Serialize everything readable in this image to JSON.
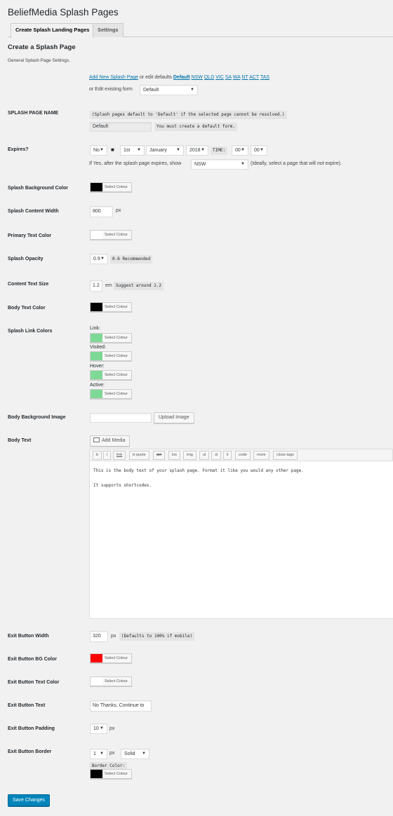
{
  "app_title": "BeliefMedia Splash Pages",
  "tabs": [
    "Create Splash Landing Pages",
    "Settings"
  ],
  "heading": "Create a Splash Page",
  "description": "General Splash Page Settings.",
  "nav": {
    "add_new": "Add New Splash Page",
    "edit_defaults_text": "or edit defaults",
    "default_link": "Default",
    "state_links": [
      "NSW",
      "QLD",
      "VIC",
      "SA",
      "WA",
      "NT",
      "ACT",
      "TAS"
    ],
    "edit_existing_text": "or Edit existing form",
    "existing_value": "Default"
  },
  "labels": {
    "name": "SPLASH PAGE NAME",
    "expires": "Expires?",
    "bg_color": "Splash Background Color",
    "content_width": "Splash Content Width",
    "primary_text": "Primary Text Color",
    "opacity": "Splash Opacity",
    "text_size": "Content Text Size",
    "body_text_color": "Body Text Color",
    "link_colors": "Splash Link Colors",
    "bg_image": "Body Background Image",
    "body_text": "Body Text",
    "exit_width": "Exit Button Width",
    "exit_bg": "Exit Button BG Color",
    "exit_text_color": "Exit Button Text Color",
    "exit_text": "Exit Button Text",
    "exit_padding": "Exit Button Padding",
    "exit_border": "Exit Button Border"
  },
  "name": {
    "note": "(Splash pages default to 'Default' if the selected page cannot be resolved.)",
    "value": "Default",
    "warning": "You must create a default form."
  },
  "expires": {
    "enabled": "No",
    "square": "■",
    "day": "1st",
    "month": "January",
    "year": "2018",
    "time_label": "TIME:",
    "hour": "00",
    "minute": "00",
    "after_text": "If Yes, after the splash page expires, show",
    "after_value": "NSW",
    "hint_pre": "(Ideally, select a page that will",
    "hint_em": "not",
    "hint_post": "expire)."
  },
  "select_colour": "Select Colour",
  "colors": {
    "bg": "#000000",
    "primary_text": "#ffffff",
    "body_text": "#000000",
    "link": "#7ed896",
    "visited": "#7ed896",
    "hover": "#7ed896",
    "active": "#7ed896",
    "exit_bg": "#ff0000",
    "exit_text": "#ffffff",
    "border": "#000000"
  },
  "content_width": {
    "value": "800",
    "unit": "px"
  },
  "opacity": {
    "value": "0.9",
    "note": "0.6 Recommended"
  },
  "text_size": {
    "value": "1.2",
    "unit": "em",
    "note": "Suggest around 1.2"
  },
  "link_labels": {
    "link": "Link:",
    "visited": "Visited:",
    "hover": "Hover:",
    "active": "Active:"
  },
  "bg_image": {
    "value": "",
    "button": "Upload Image"
  },
  "editor": {
    "add_media": "Add Media",
    "quicktags": [
      "b",
      "i",
      "link",
      "b-quote",
      "del",
      "ins",
      "img",
      "ul",
      "ol",
      "li",
      "code",
      "more",
      "close tags"
    ],
    "paragraphs": [
      "This is the body text of your splash page. Format it like you would any other page.",
      "It supports shortcodes."
    ]
  },
  "exit_width": {
    "value": "320",
    "unit": "px",
    "note": "(Defaults to 100% if mobile)"
  },
  "exit_text": {
    "value": "No Thanks, Continue to"
  },
  "exit_padding": {
    "value": "10",
    "unit": "px"
  },
  "exit_border": {
    "width": "1",
    "unit": "px",
    "style": "Solid",
    "color_label": "Border Color:"
  },
  "save_label": "Save Changes"
}
